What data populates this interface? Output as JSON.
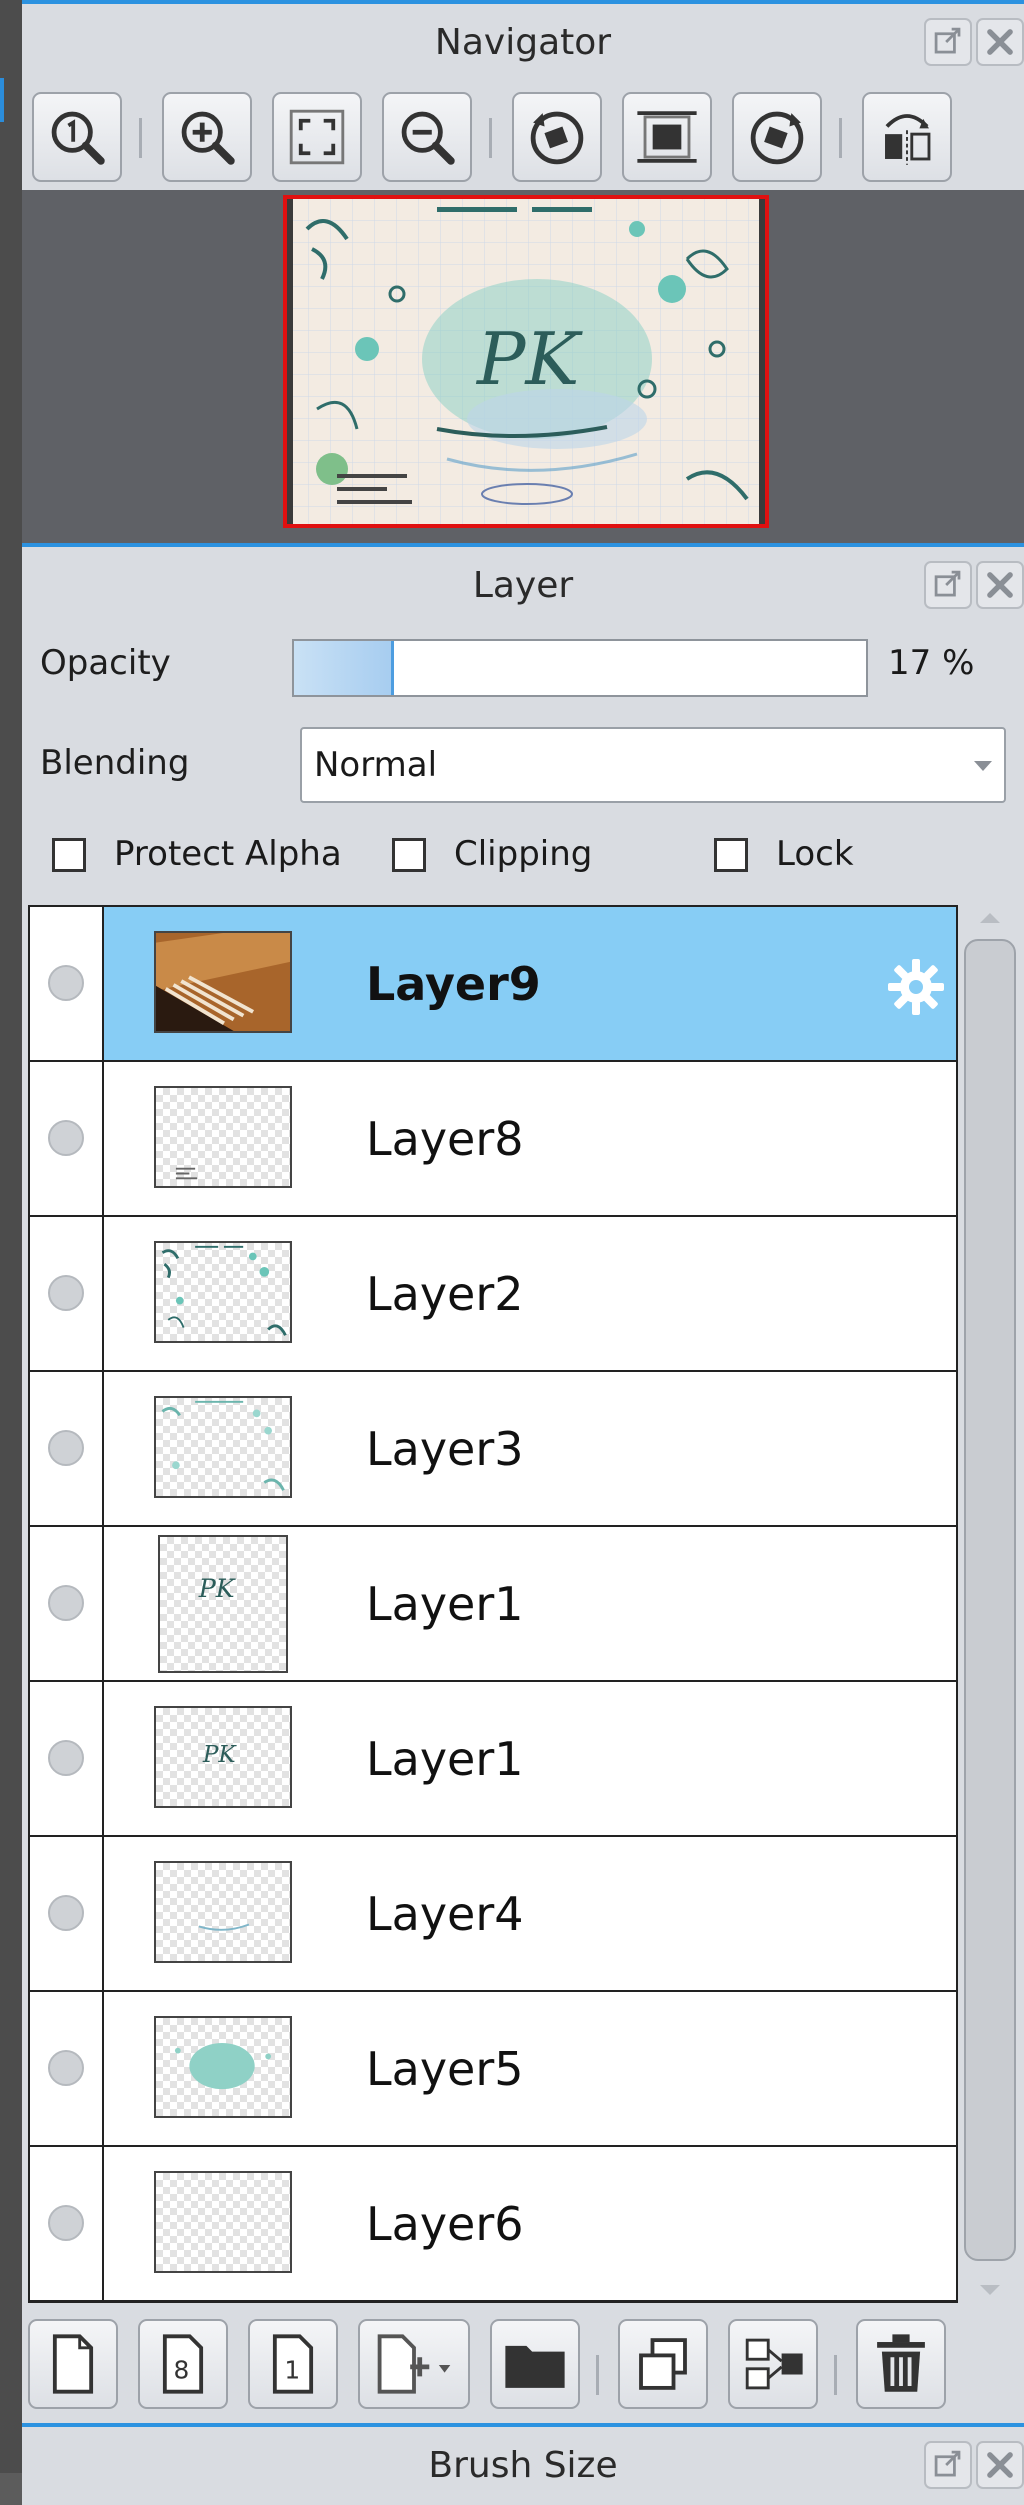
{
  "navigator": {
    "title": "Navigator",
    "toolbar": [
      {
        "id": "zoom-actual",
        "icon": "zoom-actual-size-icon"
      },
      {
        "id": "zoom-in",
        "icon": "zoom-in-icon"
      },
      {
        "id": "fit",
        "icon": "fit-to-window-icon"
      },
      {
        "id": "zoom-out",
        "icon": "zoom-out-icon"
      },
      {
        "id": "rotate-left",
        "icon": "rotate-left-icon"
      },
      {
        "id": "reset-rotation",
        "icon": "reset-rotation-icon"
      },
      {
        "id": "rotate-right",
        "icon": "rotate-right-icon"
      },
      {
        "id": "flip",
        "icon": "flip-horizontal-icon"
      }
    ],
    "preview_text": "PK"
  },
  "layer": {
    "title": "Layer",
    "opacity_label": "Opacity",
    "opacity_value": "17 %",
    "opacity_fraction": 0.17,
    "blending_label": "Blending",
    "blending_value": "Normal",
    "checkboxes": {
      "protect_alpha": {
        "label": "Protect Alpha",
        "checked": false
      },
      "clipping": {
        "label": "Clipping",
        "checked": false
      },
      "lock": {
        "label": "Lock",
        "checked": false
      }
    },
    "items": [
      {
        "name": "Layer9",
        "selected": true,
        "thumb": "photo"
      },
      {
        "name": "Layer8",
        "selected": false,
        "thumb": "text"
      },
      {
        "name": "Layer2",
        "selected": false,
        "thumb": "decor"
      },
      {
        "name": "Layer3",
        "selected": false,
        "thumb": "decor-light"
      },
      {
        "name": "Layer1",
        "selected": false,
        "thumb": "pk"
      },
      {
        "name": "Layer1",
        "selected": false,
        "thumb": "pk"
      },
      {
        "name": "Layer4",
        "selected": false,
        "thumb": "line"
      },
      {
        "name": "Layer5",
        "selected": false,
        "thumb": "blob"
      },
      {
        "name": "Layer6",
        "selected": false,
        "thumb": "empty"
      }
    ],
    "toolbar": [
      {
        "id": "new-layer",
        "icon": "new-layer-icon"
      },
      {
        "id": "new-8bit-layer",
        "icon": "new-8bit-layer-icon",
        "text": "8"
      },
      {
        "id": "new-1bit-layer",
        "icon": "new-1bit-layer-icon",
        "text": "1"
      },
      {
        "id": "add-layer-menu",
        "icon": "add-layer-menu-icon"
      },
      {
        "id": "new-folder",
        "icon": "folder-icon"
      },
      {
        "id": "duplicate",
        "icon": "duplicate-layer-icon"
      },
      {
        "id": "merge-down",
        "icon": "merge-down-icon"
      },
      {
        "id": "delete",
        "icon": "trash-icon"
      }
    ]
  },
  "brush": {
    "title": "Brush Size"
  },
  "colors": {
    "accent": "#2c92e0",
    "selection": "#87cdf5",
    "panel": "#d9dce1",
    "preview_border": "#e01010"
  }
}
